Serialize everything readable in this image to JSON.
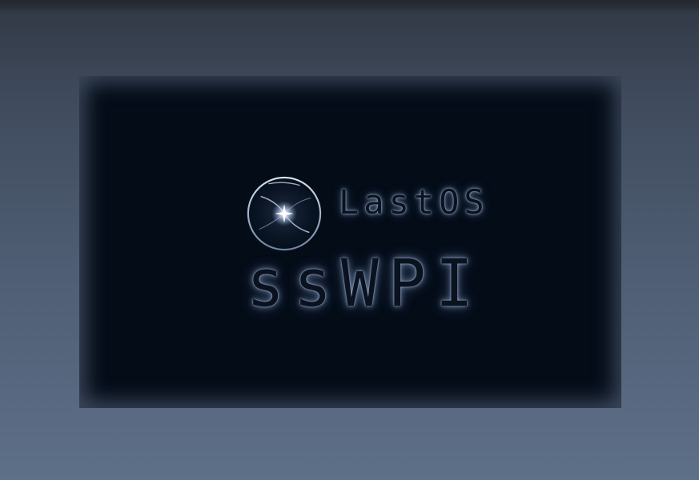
{
  "splash": {
    "brand_top": "LastOS",
    "brand_main": "ssWPI",
    "logo_icon": "glass-orb-icon"
  },
  "colors": {
    "background_top": "#2b313b",
    "background_bottom": "#5e6f88",
    "panel": "#040c18",
    "glow": "#6f86a8"
  }
}
